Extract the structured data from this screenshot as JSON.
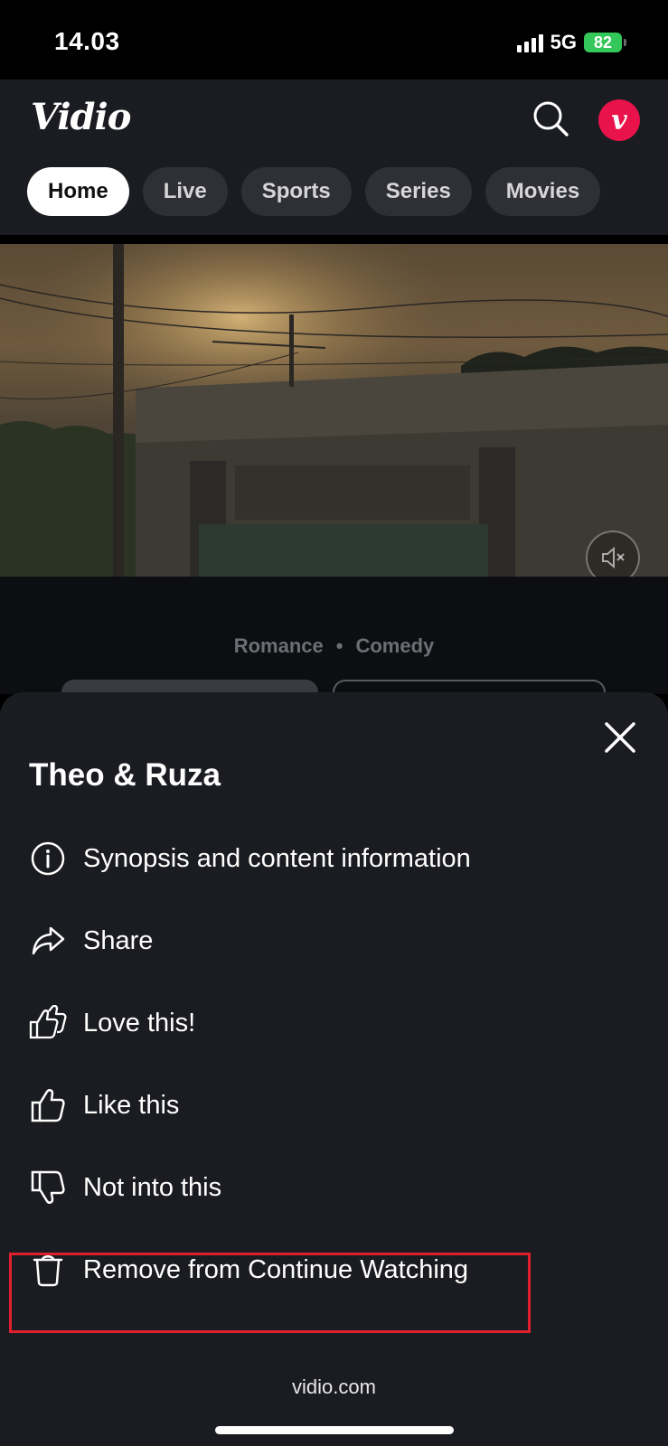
{
  "status_bar": {
    "time": "14.03",
    "network": "5G",
    "battery": "82"
  },
  "header": {
    "logo": "Vidio",
    "avatar_letter": "v",
    "tabs": [
      {
        "label": "Home",
        "active": true
      },
      {
        "label": "Live",
        "active": false
      },
      {
        "label": "Sports",
        "active": false
      },
      {
        "label": "Series",
        "active": false
      },
      {
        "label": "Movies",
        "active": false
      }
    ]
  },
  "hero": {
    "genres": [
      "Romance",
      "Comedy"
    ]
  },
  "sheet": {
    "title": "Theo & Ruza",
    "items": [
      {
        "label": "Synopsis and content information",
        "icon": "info-icon"
      },
      {
        "label": "Share",
        "icon": "share-icon"
      },
      {
        "label": "Love this!",
        "icon": "double-thumbs-up-icon"
      },
      {
        "label": "Like this",
        "icon": "thumbs-up-icon"
      },
      {
        "label": "Not into this",
        "icon": "thumbs-down-icon"
      },
      {
        "label": "Remove from Continue Watching",
        "icon": "trash-icon"
      }
    ]
  },
  "footer": {
    "url": "vidio.com"
  },
  "colors": {
    "brand": "#e8134a",
    "sheet_bg": "#1b1c21",
    "highlight": "#e0202c",
    "battery": "#34c759"
  }
}
